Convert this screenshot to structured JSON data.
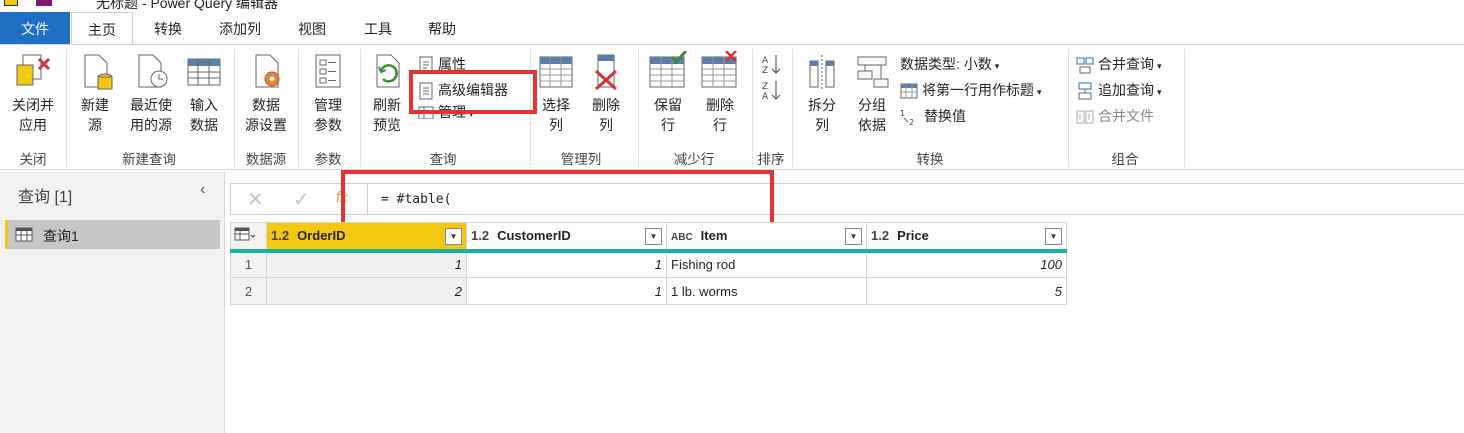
{
  "window": {
    "title": "无标题 - Power Query 编辑器"
  },
  "tabs": [
    "文件",
    "主页",
    "转换",
    "添加列",
    "视图",
    "工具",
    "帮助"
  ],
  "ribbon": {
    "close": {
      "btn": "关闭并\n应用",
      "group": "关闭"
    },
    "new_query": {
      "group": "新建查询",
      "new_source": "新建\n源",
      "recent_sources": "最近使\n用的源",
      "enter_data": "输入\n数据"
    },
    "data_source": {
      "group": "数据源",
      "settings": "数据\n源设置"
    },
    "parameters": {
      "group": "参数",
      "manage": "管理\n参数"
    },
    "query": {
      "group": "查询",
      "refresh": "刷新\n预览",
      "properties": "属性",
      "advanced_editor": "高级编辑器",
      "manage": "管理"
    },
    "manage_columns": {
      "group": "管理列",
      "choose": "选择\n列",
      "remove": "删除\n列"
    },
    "reduce_rows": {
      "group": "减少行",
      "keep": "保留\n行",
      "remove": "删除\n行"
    },
    "sort": {
      "group": "排序"
    },
    "transform": {
      "group": "转换",
      "split": "拆分\n列",
      "group_by": "分组\n依据",
      "data_type": "数据类型: 小数",
      "first_row_header": "将第一行用作标题",
      "replace": "替换值"
    },
    "combine": {
      "group": "组合",
      "merge": "合并查询",
      "append": "追加查询",
      "combine_files": "合并文件"
    }
  },
  "left": {
    "header": "查询 [1]",
    "query_name": "查询1"
  },
  "formula": {
    "text": "= #table("
  },
  "table": {
    "columns": [
      {
        "type": "1.2",
        "name": "OrderID"
      },
      {
        "type": "1.2",
        "name": "CustomerID"
      },
      {
        "type": "ABC",
        "name": "Item"
      },
      {
        "type": "1.2",
        "name": "Price"
      }
    ],
    "rows": [
      {
        "n": "1",
        "cells": [
          "1",
          "1",
          "Fishing rod",
          "100"
        ]
      },
      {
        "n": "2",
        "cells": [
          "2",
          "1",
          "1 lb. worms",
          "5"
        ]
      }
    ]
  },
  "colors": {
    "file_tab": "#1f6fc5",
    "accent_teal": "#1ab1a1",
    "highlight_red": "#e63232",
    "selected_header": "#f2c811"
  }
}
